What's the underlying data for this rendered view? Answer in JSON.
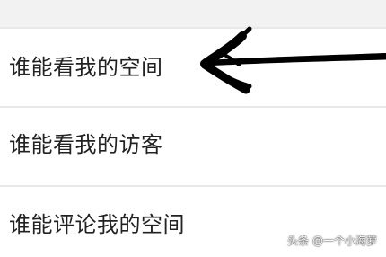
{
  "settings_list": {
    "items": [
      {
        "label": "谁能看我的空间"
      },
      {
        "label": "谁能看我的访客"
      },
      {
        "label": "谁能评论我的空间"
      }
    ]
  },
  "annotation": {
    "icon": "hand-drawn-arrow-icon",
    "color": "#000000"
  },
  "watermark": {
    "text": "头条 @一个小海萝"
  }
}
